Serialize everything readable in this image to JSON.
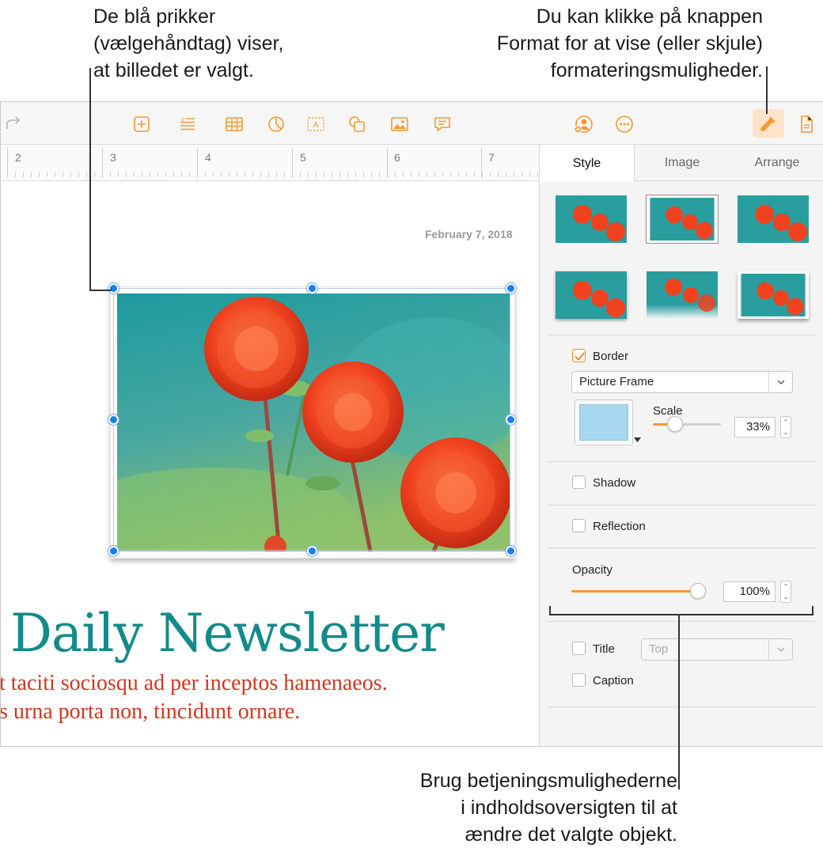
{
  "callouts": {
    "selection": [
      "De blå prikker",
      "(vælgehåndtag) viser,",
      "at billedet er valgt."
    ],
    "format": [
      "Du kan klikke på knappen",
      "Format for at vise (eller skjule)",
      "formateringsmuligheder."
    ],
    "sidebar": [
      "Brug betjeningsmulighederne",
      "i indholdsoversigten til at",
      "ændre det valgte objekt."
    ]
  },
  "toolbar": {
    "icons": [
      "redo-icon",
      "add-page-icon",
      "insert-list-icon",
      "table-icon",
      "chart-icon",
      "text-box-icon",
      "shape-icon",
      "media-icon",
      "comment-icon",
      "collaborate-icon",
      "more-icon",
      "format-icon",
      "document-icon"
    ]
  },
  "ruler": {
    "numbers": [
      "2",
      "3",
      "4",
      "5",
      "6",
      "7"
    ]
  },
  "document": {
    "date": "February 7, 2018",
    "headline": "Daily Newsletter",
    "body": [
      "t taciti sociosqu ad per inceptos hamenaeos.",
      "s urna porta non, tincidunt ornare."
    ]
  },
  "sidebar": {
    "tabs": [
      "Style",
      "Image",
      "Arrange"
    ],
    "active_tab": "Style",
    "border": {
      "label": "Border",
      "checked": true,
      "style": "Picture Frame",
      "scale_label": "Scale",
      "scale_value": "33%",
      "scale_fraction": 0.33,
      "color": "#a9d7ef"
    },
    "shadow": {
      "label": "Shadow",
      "checked": false
    },
    "reflection": {
      "label": "Reflection",
      "checked": false
    },
    "opacity": {
      "label": "Opacity",
      "value": "100%",
      "fraction": 1.0
    },
    "title": {
      "label": "Title",
      "checked": false,
      "position": "Top"
    },
    "caption": {
      "label": "Caption",
      "checked": false
    }
  },
  "colors": {
    "accent": "#f29a32",
    "headline": "#138b8a",
    "body": "#d3361e",
    "handle": "#1b7ef7"
  }
}
